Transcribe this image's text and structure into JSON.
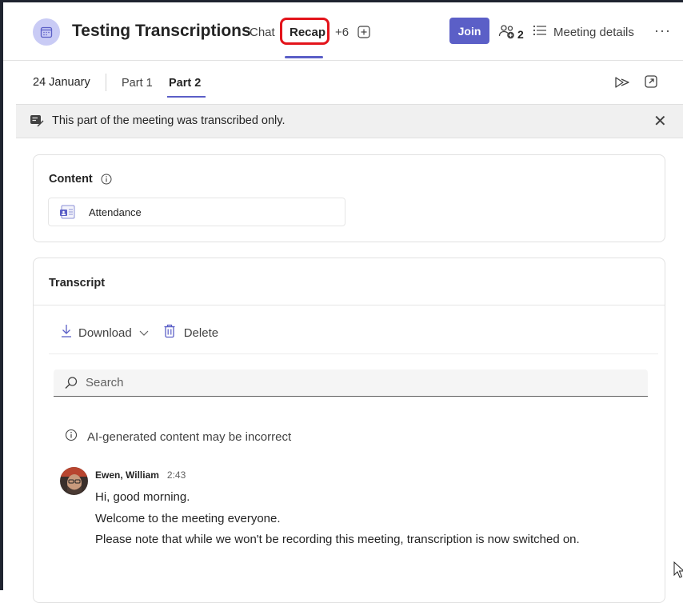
{
  "header": {
    "title": "Testing Transcriptions",
    "tabs": {
      "chat": "Chat",
      "recap": "Recap",
      "more": "+6"
    },
    "join_label": "Join",
    "participants_count": "2",
    "details_label": "Meeting details",
    "more_label": "···"
  },
  "subnav": {
    "date": "24 January",
    "parts": [
      "Part 1",
      "Part 2"
    ],
    "selected_part": "Part 2"
  },
  "banner": {
    "text": "This part of the meeting was transcribed only.",
    "close": "✕"
  },
  "content": {
    "label": "Content",
    "attachments": [
      {
        "label": "Attendance"
      }
    ]
  },
  "transcript": {
    "title": "Transcript",
    "download_label": "Download",
    "delete_label": "Delete",
    "search_placeholder": "Search",
    "ai_notice": "AI-generated content may be incorrect",
    "entries": [
      {
        "speaker": "Ewen, William",
        "time": "2:43",
        "lines": [
          "Hi, good morning.",
          "Welcome to the meeting everyone.",
          "Please note that while we won't be recording this meeting, transcription is now switched on."
        ]
      }
    ]
  },
  "colors": {
    "accent": "#5b5fc7",
    "highlight_box": "#e3141b",
    "banner_bg": "#f0f0f0"
  }
}
